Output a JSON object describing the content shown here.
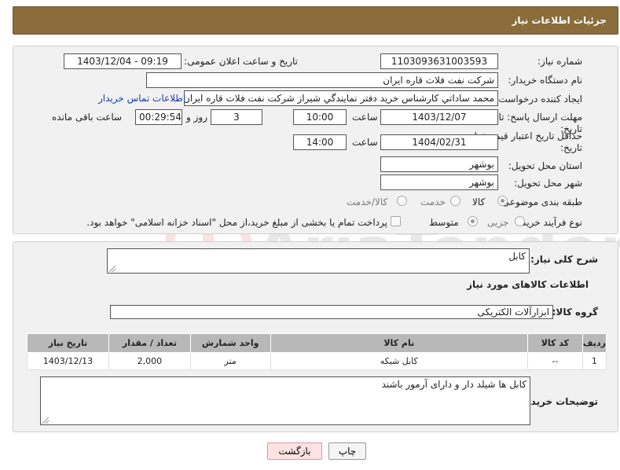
{
  "header": {
    "title": "جزئیات اطلاعات نیاز"
  },
  "form": {
    "need_number_label": "شماره نیاز:",
    "need_number": "1103093631003593",
    "announce_label": "تاریخ و ساعت اعلان عمومی:",
    "announce_value": "1403/12/04 - 09:19",
    "buyer_org_label": "نام دستگاه خریدار:",
    "buyer_org": "شرکت نفت فلات قاره ایران",
    "creator_label": "ایجاد کننده درخواست:",
    "creator": "محمد ساداتي کارشناس خريد دفتر نمايندگي شيراز شرکت نفت فلات قاره ايران",
    "contact_link": "اطلاعات تماس خریدار",
    "reply_deadline_label": "مهلت ارسال پاسخ: تا تاریخ:",
    "reply_date": "1403/12/07",
    "hour_label": "ساعت",
    "reply_time": "10:00",
    "days_value": "3",
    "days_label": "روز و",
    "remaining_time": "00:29:54",
    "remaining_label": "ساعت باقی مانده",
    "price_validity_label": "حداقل تاریخ اعتبار قیمت: تا تاریخ:",
    "price_date": "1404/02/31",
    "price_time": "14:00",
    "province_label": "استان محل تحویل:",
    "province": "بوشهر",
    "city_label": "شهر محل تحویل:",
    "city": "بوشهر",
    "category_label": "طبقه بندی موضوعی:",
    "category_options": [
      "کالا",
      "خدمت",
      "کالا/خدمت"
    ],
    "category_selected": "کالا",
    "process_label": "نوع فرآیند خرید :",
    "process_options": [
      "جزیی",
      "متوسط"
    ],
    "process_selected": "متوسط",
    "payment_note": "پرداخت تمام یا بخشی از مبلغ خرید،از محل \"اسناد خزانه اسلامی\" خواهد بود."
  },
  "details": {
    "summary_label": "شرح کلی نیاز:",
    "summary": "کابل",
    "goods_info_title": "اطلاعات کالاهای مورد نیاز",
    "group_label": "گروه کالا:",
    "group": "ابزارآلات الکتریکی",
    "table": {
      "headers": [
        "ردیف",
        "کد کالا",
        "نام کالا",
        "واحد شمارش",
        "تعداد / مقدار",
        "تاریخ نیاز"
      ],
      "rows": [
        [
          "1",
          "--",
          "کابل شبکه",
          "متر",
          "2,000",
          "1403/12/13"
        ]
      ]
    },
    "buyer_notes_label": "توضیحات خریدار:",
    "buyer_notes": "کابل ها شیلد دار و دارای آرمور باشند"
  },
  "buttons": {
    "print": "چاپ",
    "back": "بازگشت"
  },
  "watermark": {
    "text": "AriaTender.neT"
  },
  "colors": {
    "header_bg": "#8a6d3b",
    "panel_bg": "#f1f1f1",
    "table_header_bg": "#b8b8b8",
    "link": "#1a3fa8",
    "back_button_bg": "#fde2e2"
  }
}
